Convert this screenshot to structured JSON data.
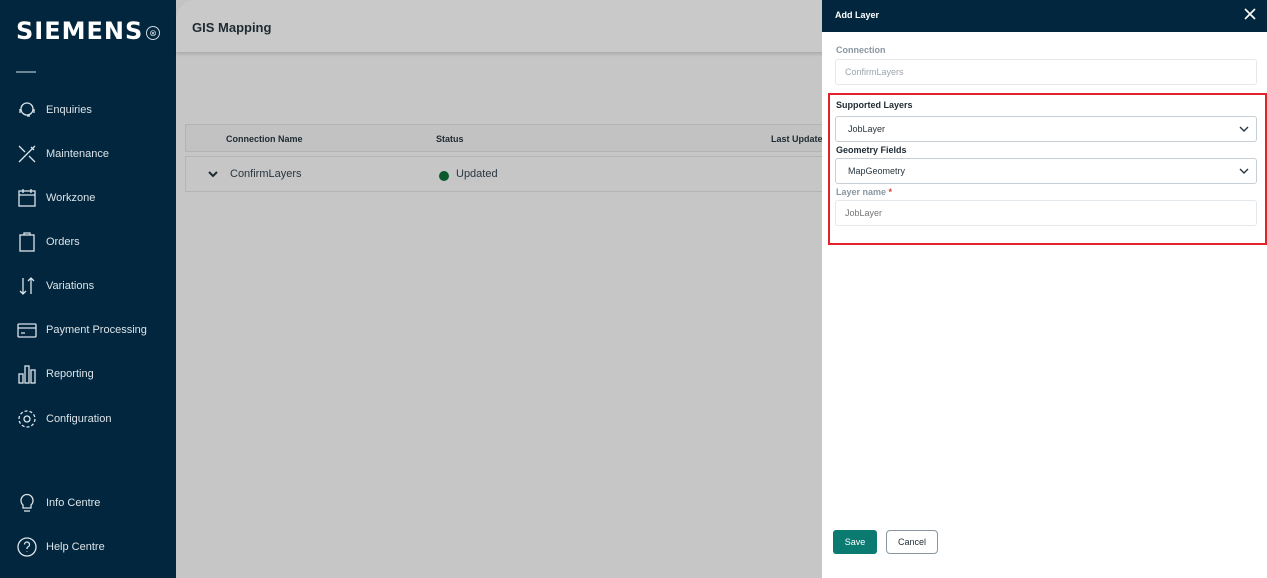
{
  "sidebar": {
    "brand": "SIEMENS",
    "items": [
      {
        "label": "Enquiries",
        "icon": "headset-icon"
      },
      {
        "label": "Maintenance",
        "icon": "tools-icon"
      },
      {
        "label": "Workzone",
        "icon": "calendar-icon"
      },
      {
        "label": "Orders",
        "icon": "clipboard-icon"
      },
      {
        "label": "Variations",
        "icon": "arrows-updown-icon"
      },
      {
        "label": "Payment Processing",
        "icon": "card-icon"
      },
      {
        "label": "Reporting",
        "icon": "bar-chart-icon"
      },
      {
        "label": "Configuration",
        "icon": "gear-icon"
      },
      {
        "label": "Info Centre",
        "icon": "lightbulb-icon"
      },
      {
        "label": "Help Centre",
        "icon": "help-icon"
      }
    ]
  },
  "main": {
    "title": "GIS Mapping",
    "table": {
      "columns": [
        "Connection Name",
        "Status",
        "Last Update"
      ],
      "rows": [
        {
          "name": "ConfirmLayers",
          "status": "Updated"
        }
      ]
    }
  },
  "drawer": {
    "title": "Add Layer",
    "connection_label": "Connection",
    "connection_value": "ConfirmLayers",
    "supported_layers_label": "Supported Layers",
    "supported_layers_value": "JobLayer",
    "geometry_fields_label": "Geometry Fields",
    "geometry_fields_value": "MapGeometry",
    "layer_name_label": "Layer name",
    "layer_name_required": "*",
    "layer_name_placeholder": "JobLayer",
    "save_label": "Save",
    "cancel_label": "Cancel"
  },
  "colors": {
    "sidebar_bg": "#02263d",
    "accent": "#0b7a70",
    "status_updated": "#0a5a2e",
    "highlight": "#e0222b"
  }
}
